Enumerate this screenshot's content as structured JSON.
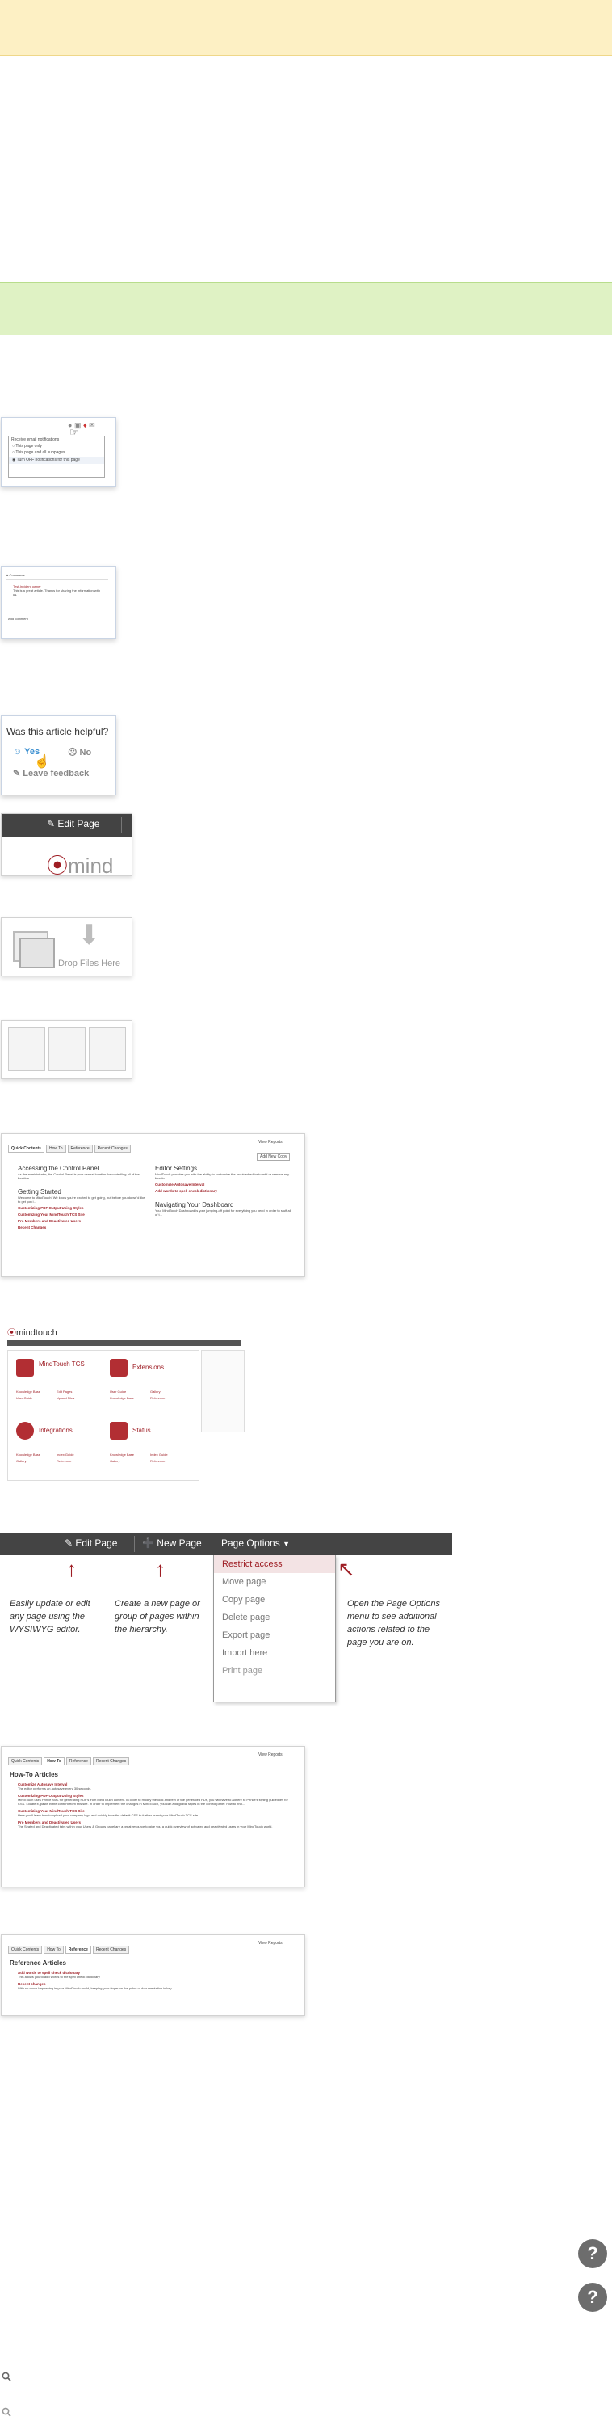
{
  "email_notif": {
    "header": "Receive email notifications",
    "options": [
      "This page only",
      "This page and all subpages",
      "Turn OFF notifications for this page"
    ]
  },
  "comments": {
    "title": "Comments",
    "author": "Test-Incident owner",
    "text": "This is a great article. Thanks for sharing the information with us.",
    "add": "Add comment"
  },
  "feedback": {
    "question": "Was this article helpful?",
    "yes": "Yes",
    "no": "No",
    "leave": "Leave feedback"
  },
  "edit_page_crop": {
    "label": "Edit Page",
    "logo_text": "mind"
  },
  "drop_files": {
    "label": "Drop Files Here"
  },
  "control_panel": {
    "tabs": [
      "Quick Contents",
      "How To",
      "Reference",
      "Recent Changes"
    ],
    "view_reports": "View Reports",
    "add_new_copy": "Add New Copy",
    "left": [
      {
        "heading": "Accessing the Control Panel",
        "text": "As the administrator, the Control Panel is your central location for controlling all of the function..."
      },
      {
        "heading": "Getting Started",
        "text": "Welcome to MindTouch! We know you're excited to get going, but before you do we'd like to get you i..."
      }
    ],
    "left_links": [
      "Customizing PDF Output Using Styles",
      "Customizing Your MindTouch TCS Site",
      "Pro Members and Deactivated Users",
      "Recent Changes"
    ],
    "right": [
      {
        "heading": "Editor Settings",
        "text": "MindTouch provides you with the ability to customize the provided editor to add or remove any functio..."
      },
      {
        "heading": "Navigating Your Dashboard",
        "text": "Your MindTouch Dashboard is your jumping-off point for everything you need in order to stuff all of t..."
      }
    ],
    "right_links": [
      "Customize Autosave Interval",
      "Add words to spell check dictionary"
    ]
  },
  "dashboard": {
    "logo": "mindtouch",
    "tiles": [
      {
        "title": "MindTouch TCS",
        "links": [
          "Knowledge Base",
          "Edit Pages",
          "User Guide",
          "Upload Files"
        ]
      },
      {
        "title": "Extensions",
        "links": [
          "User Guide",
          "Gallery",
          "Knowledge Base",
          "Reference"
        ]
      },
      {
        "title": "Integrations",
        "links": [
          "Knowledge Base",
          "Index Guide",
          "Gallery",
          "Reference"
        ]
      },
      {
        "title": "Status",
        "links": [
          "Knowledge Base",
          "Index Guide",
          "Gallery",
          "Reference"
        ]
      }
    ]
  },
  "toolbar": {
    "edit_page": "Edit Page",
    "new_page": "New Page",
    "page_options": "Page Options",
    "menu": [
      "Restrict access",
      "Move page",
      "Copy page",
      "Delete page",
      "Export page",
      "Import here",
      "Print page"
    ],
    "callout_edit": "Easily update or edit any page using the WYSIWYG editor.",
    "callout_new": "Create a new page or group of pages within the hierarchy.",
    "callout_options": "Open the Page Options menu to see additional actions related to the page you are on."
  },
  "howto": {
    "tabs": [
      "Quick Contents",
      "How To",
      "Reference",
      "Recent Changes"
    ],
    "view_reports": "View Reports",
    "title": "How-To Articles",
    "items": [
      {
        "link": "Customize Autosave Interval",
        "text": "The editor performs an autosave every 30 seconds."
      },
      {
        "link": "Customizing PDF Output Using Styles",
        "text": "MindTouch uses Prince XML for generating PDF's from MindTouch content. In order to modify the look and feel of the generated PDF, you will have to adhere to Prince's styling guidelines for CSS. Locate it, paste in the content from this site. In order to implement the changes in MindTouch, you can add global styles in the control panel: how to find..."
      },
      {
        "link": "Customizing Your MindTouch TCS Site",
        "text": "Here you'll learn how to upload your company logo and quickly tune the default CSS to further brand your MindTouch TCS site."
      },
      {
        "link": "Pro Members and Deactivated Users",
        "text": "The Seated and Deactivated tabs within your Users & Groups panel are a great resource to give you a quick overview of activated and deactivated users in your MindTouch world."
      }
    ]
  },
  "reference": {
    "tabs": [
      "Quick Contents",
      "How To",
      "Reference",
      "Recent Changes"
    ],
    "view_reports": "View Reports",
    "title": "Reference Articles",
    "items": [
      {
        "link": "Add words to spell check dictionary",
        "text": "This allows you to add words to the spell check dictionary."
      },
      {
        "link": "Recent changes",
        "text": "With so much happening in your MindTouch world, keeping your finger on the pulse of documentation is key."
      }
    ]
  },
  "help_icons": [
    "?",
    "?"
  ],
  "colors": {
    "brand_red": "#9e1d24",
    "toolbar_dark": "#444444",
    "banner_yellow": "#fdf0c4",
    "banner_green": "#dff2c4"
  }
}
